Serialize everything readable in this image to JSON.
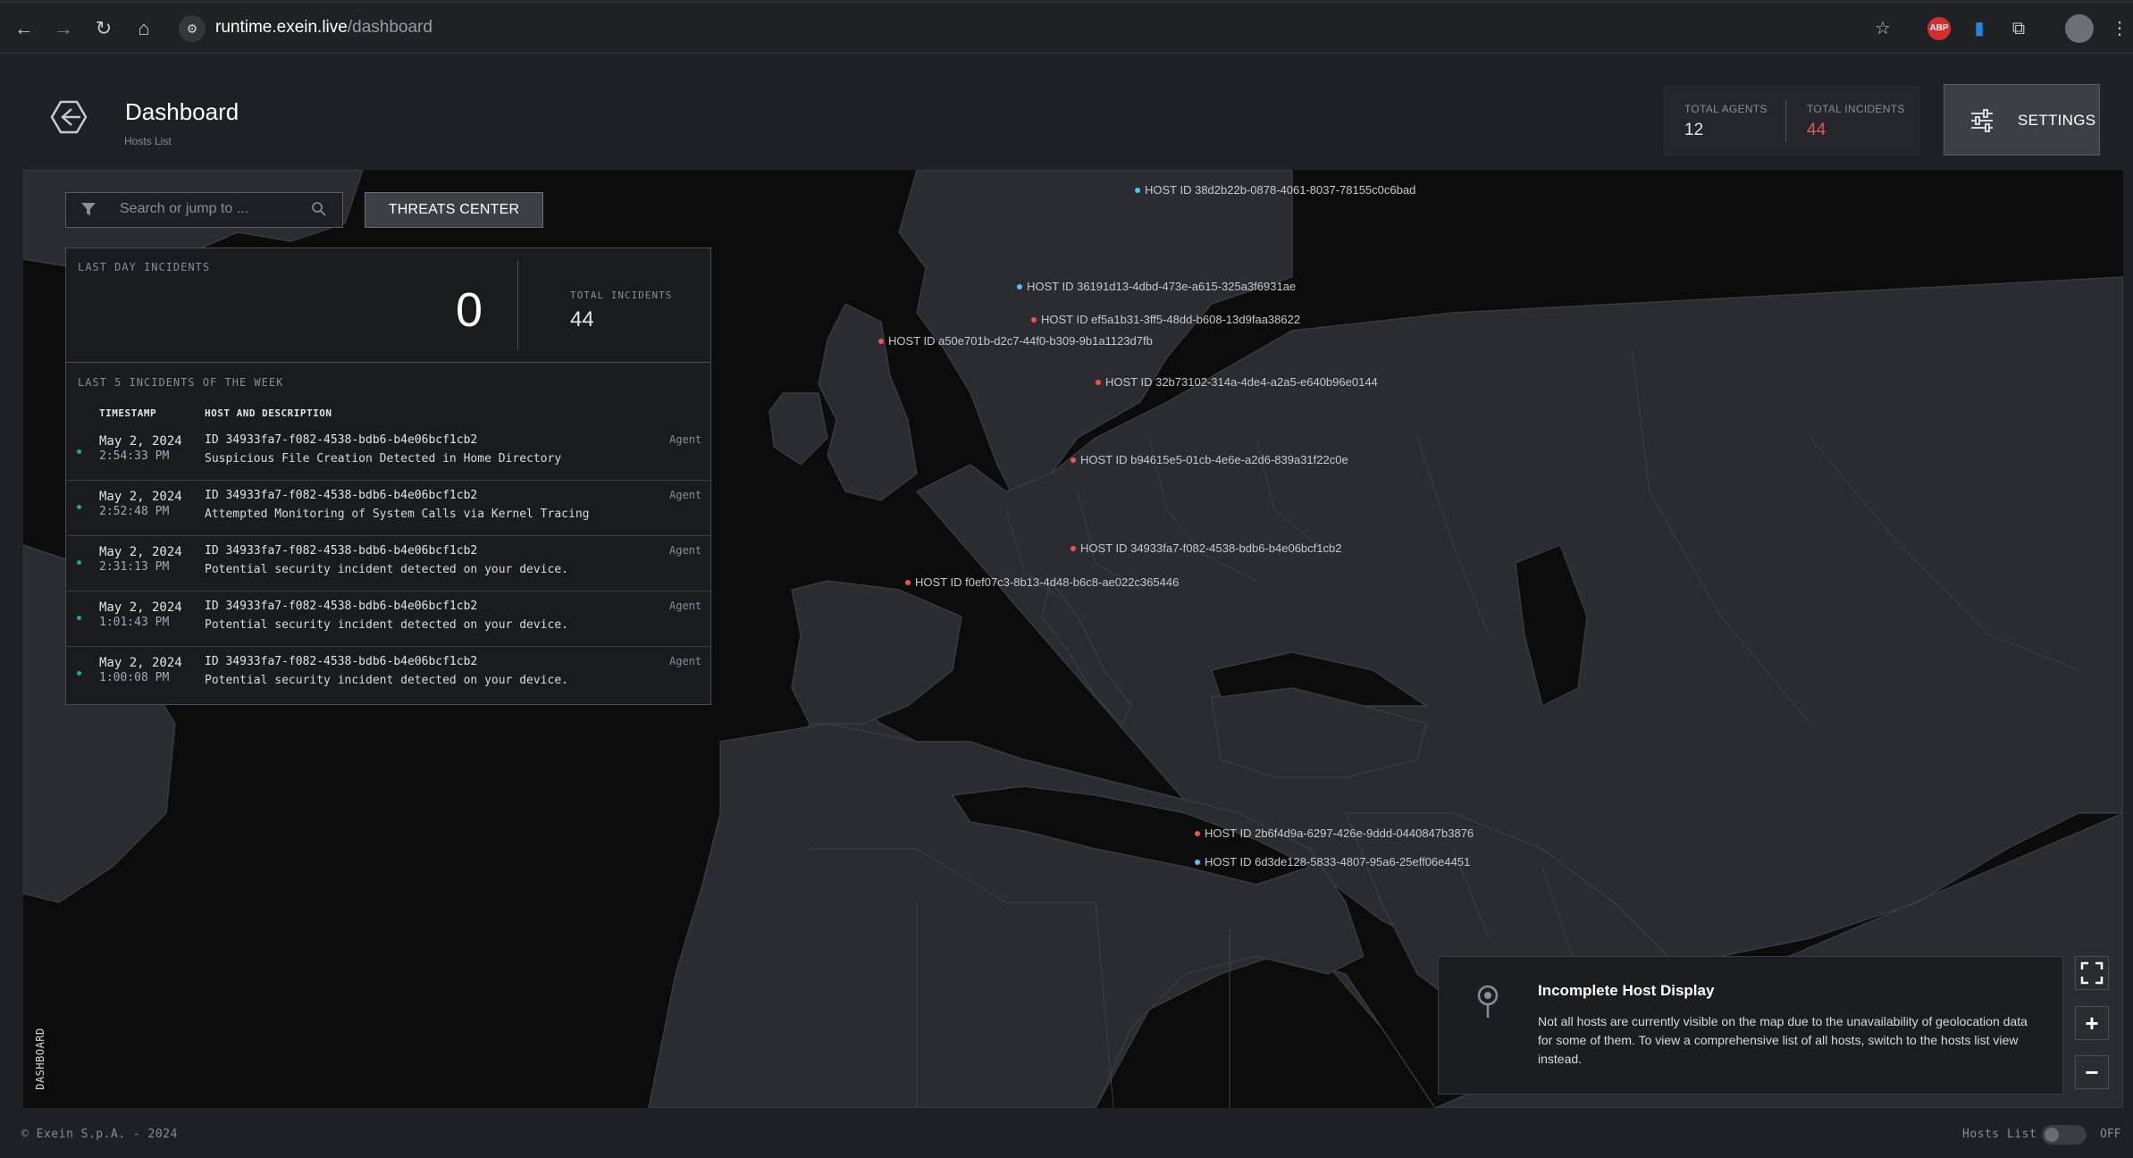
{
  "browser": {
    "url_host": "runtime.exein.live",
    "url_path": "/dashboard",
    "abp_label": "ABP"
  },
  "header": {
    "title": "Dashboard",
    "subtitle": "Hosts List",
    "total_agents_label": "TOTAL AGENTS",
    "total_agents_value": "12",
    "total_incidents_label": "TOTAL INCIDENTS",
    "total_incidents_value": "44",
    "settings_label": "SETTINGS"
  },
  "search": {
    "placeholder": "Search or jump to ..."
  },
  "threats_button": "THREATS CENTER",
  "panel": {
    "last_day_label": "LAST DAY INCIDENTS",
    "last_day_value": "0",
    "total_label": "TOTAL INCIDENTS",
    "total_value": "44",
    "week_label": "LAST 5 INCIDENTS OF THE WEEK",
    "col_timestamp": "TIMESTAMP",
    "col_host": "HOST AND DESCRIPTION",
    "incidents": [
      {
        "date": "May 2, 2024",
        "time": "2:54:33 PM",
        "host": "ID 34933fa7-f082-4538-bdb6-b4e06bcf1cb2",
        "desc": "Suspicious File Creation Detected in Home Directory",
        "tag": "Agent"
      },
      {
        "date": "May 2, 2024",
        "time": "2:52:48 PM",
        "host": "ID 34933fa7-f082-4538-bdb6-b4e06bcf1cb2",
        "desc": "Attempted Monitoring of System Calls via Kernel Tracing",
        "tag": "Agent"
      },
      {
        "date": "May 2, 2024",
        "time": "2:31:13 PM",
        "host": "ID 34933fa7-f082-4538-bdb6-b4e06bcf1cb2",
        "desc": "Potential security incident detected on your device.",
        "tag": "Agent"
      },
      {
        "date": "May 2, 2024",
        "time": "1:01:43 PM",
        "host": "ID 34933fa7-f082-4538-bdb6-b4e06bcf1cb2",
        "desc": "Potential security incident detected on your device.",
        "tag": "Agent"
      },
      {
        "date": "May 2, 2024",
        "time": "1:00:08 PM",
        "host": "ID 34933fa7-f082-4538-bdb6-b4e06bcf1cb2",
        "desc": "Potential security incident detected on your device.",
        "tag": "Agent"
      }
    ]
  },
  "hosts": [
    {
      "label": "HOST ID 38d2b22b-0878-4061-8037-78155c0c6bad",
      "status": "blue"
    },
    {
      "label": "HOST ID 36191d13-4dbd-473e-a615-325a3f6931ae",
      "status": "blue"
    },
    {
      "label": "HOST ID ef5a1b31-3ff5-48dd-b608-13d9faa38622",
      "status": "red"
    },
    {
      "label": "HOST ID a50e701b-d2c7-44f0-b309-9b1a1123d7fb",
      "status": "red"
    },
    {
      "label": "HOST ID 32b73102-314a-4de4-a2a5-e640b96e0144",
      "status": "red"
    },
    {
      "label": "HOST ID b94615e5-01cb-4e6e-a2d6-839a31f22c0e",
      "status": "red"
    },
    {
      "label": "HOST ID 34933fa7-f082-4538-bdb6-b4e06bcf1cb2",
      "status": "red"
    },
    {
      "label": "HOST ID f0ef07c3-8b13-4d48-b6c8-ae022c365446",
      "status": "red"
    },
    {
      "label": "HOST ID 2b6f4d9a-6297-426e-9ddd-0440847b3876",
      "status": "red"
    },
    {
      "label": "HOST ID 6d3de128-5833-4807-95a6-25eff06e4451",
      "status": "blue"
    }
  ],
  "notice": {
    "title": "Incomplete Host Display",
    "text": "Not all hosts are currently visible on the map due to the unavailability of geolocation data for some of them. To view a comprehensive list of all hosts, switch to the hosts list view instead."
  },
  "map_controls": {
    "zoom_in": "+",
    "zoom_out": "−"
  },
  "side_tab": "DASHBOARD",
  "footer": {
    "copyright": "© Exein S.p.A. - 2024",
    "hosts_list_label": "Hosts List",
    "toggle_state": "OFF"
  },
  "colors": {
    "accent_red": "#ef5350",
    "host_blue": "#4fc3f7",
    "incident_dot": "#26a69a"
  }
}
